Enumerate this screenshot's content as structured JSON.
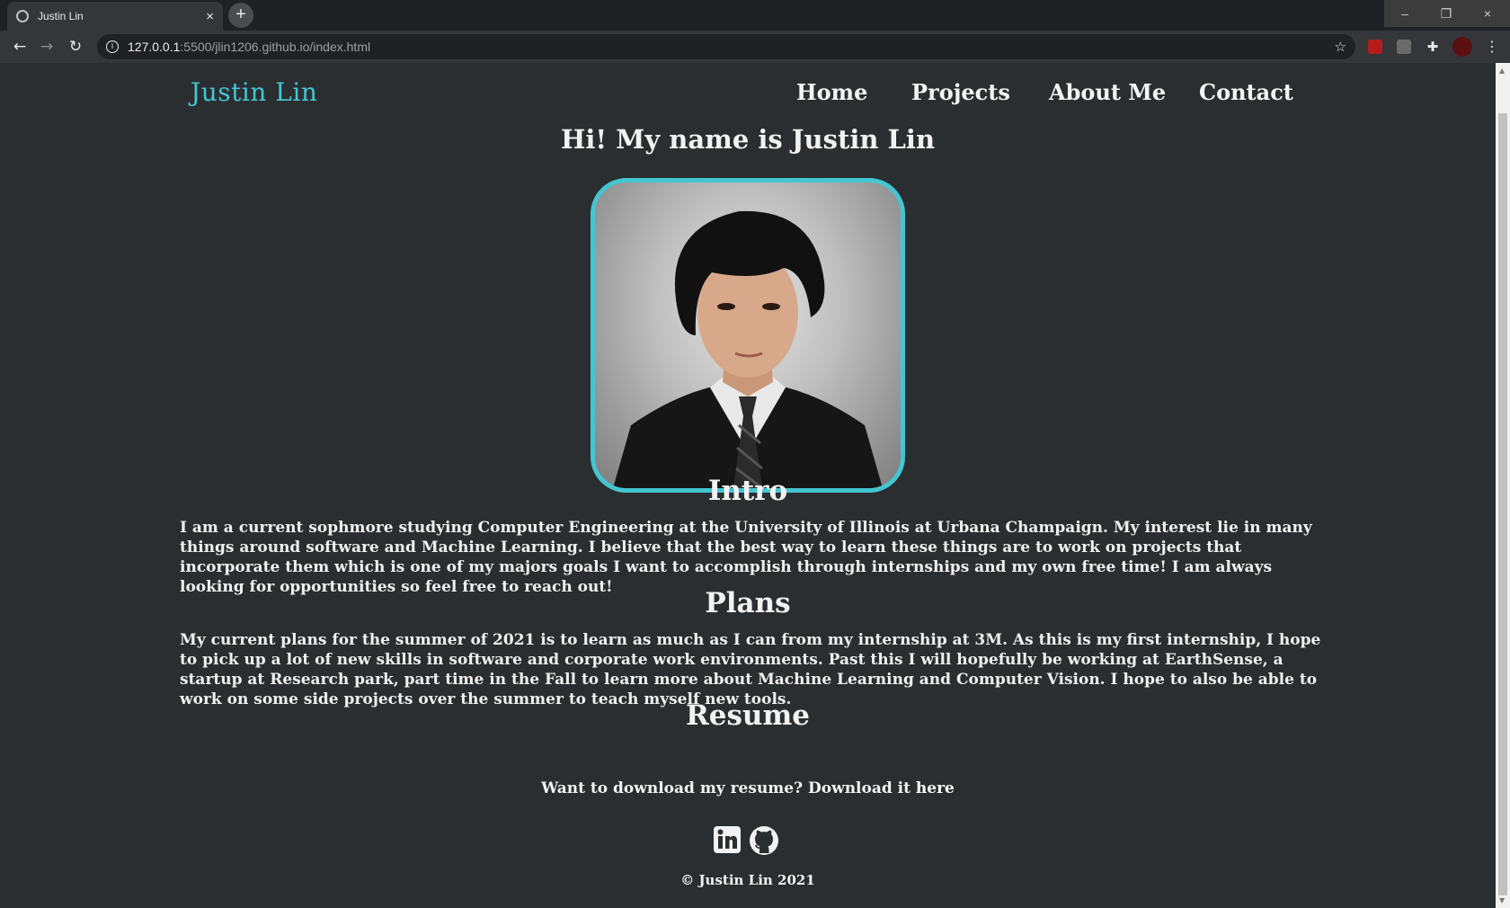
{
  "browser": {
    "tab_title": "Justin Lin",
    "tab_close": "×",
    "new_tab": "+",
    "url_host": "127.0.0.1",
    "url_path": ":5500/jlin1206.github.io/index.html",
    "window_controls": [
      "–",
      "❐",
      "×"
    ],
    "extensions": [
      "ublock-icon",
      "extension-icon",
      "puzzle-icon",
      "profile-icon"
    ]
  },
  "site": {
    "brand": "Justin Lin",
    "nav": [
      "Home",
      "Projects",
      "About Me",
      "Contact"
    ],
    "hero_title": "Hi! My name is Justin Lin",
    "intro_heading": "Intro",
    "intro_text": "I am a current sophmore studying Computer Engineering at the University of Illinois at Urbana Champaign. My interest lie in many things around software and Machine Learning. I believe that the best way to learn these things are to work on projects that incorporate them which is one of my majors goals I want to accomplish through internships and my own free time! I am always looking for opportunities so feel free to reach out!",
    "plans_heading": "Plans",
    "plans_text": "My current plans for the summer of 2021 is to learn as much as I can from my internship at 3M. As this is my first internship, I hope to pick up a lot of new skills in software and corporate work environments. Past this I will hopefully be working at EarthSense, a startup at Research park, part time in the Fall to learn more about Machine Learning and Computer Vision. I hope to also be able to work on some side projects over the summer to teach myself new tools.",
    "resume_heading": "Resume",
    "resume_text": "Want to download my resume? Download it ",
    "resume_link": "here",
    "footer": "© Justin Lin 2021"
  },
  "colors": {
    "accent": "#43c6d1",
    "background": "#2b2e31"
  }
}
